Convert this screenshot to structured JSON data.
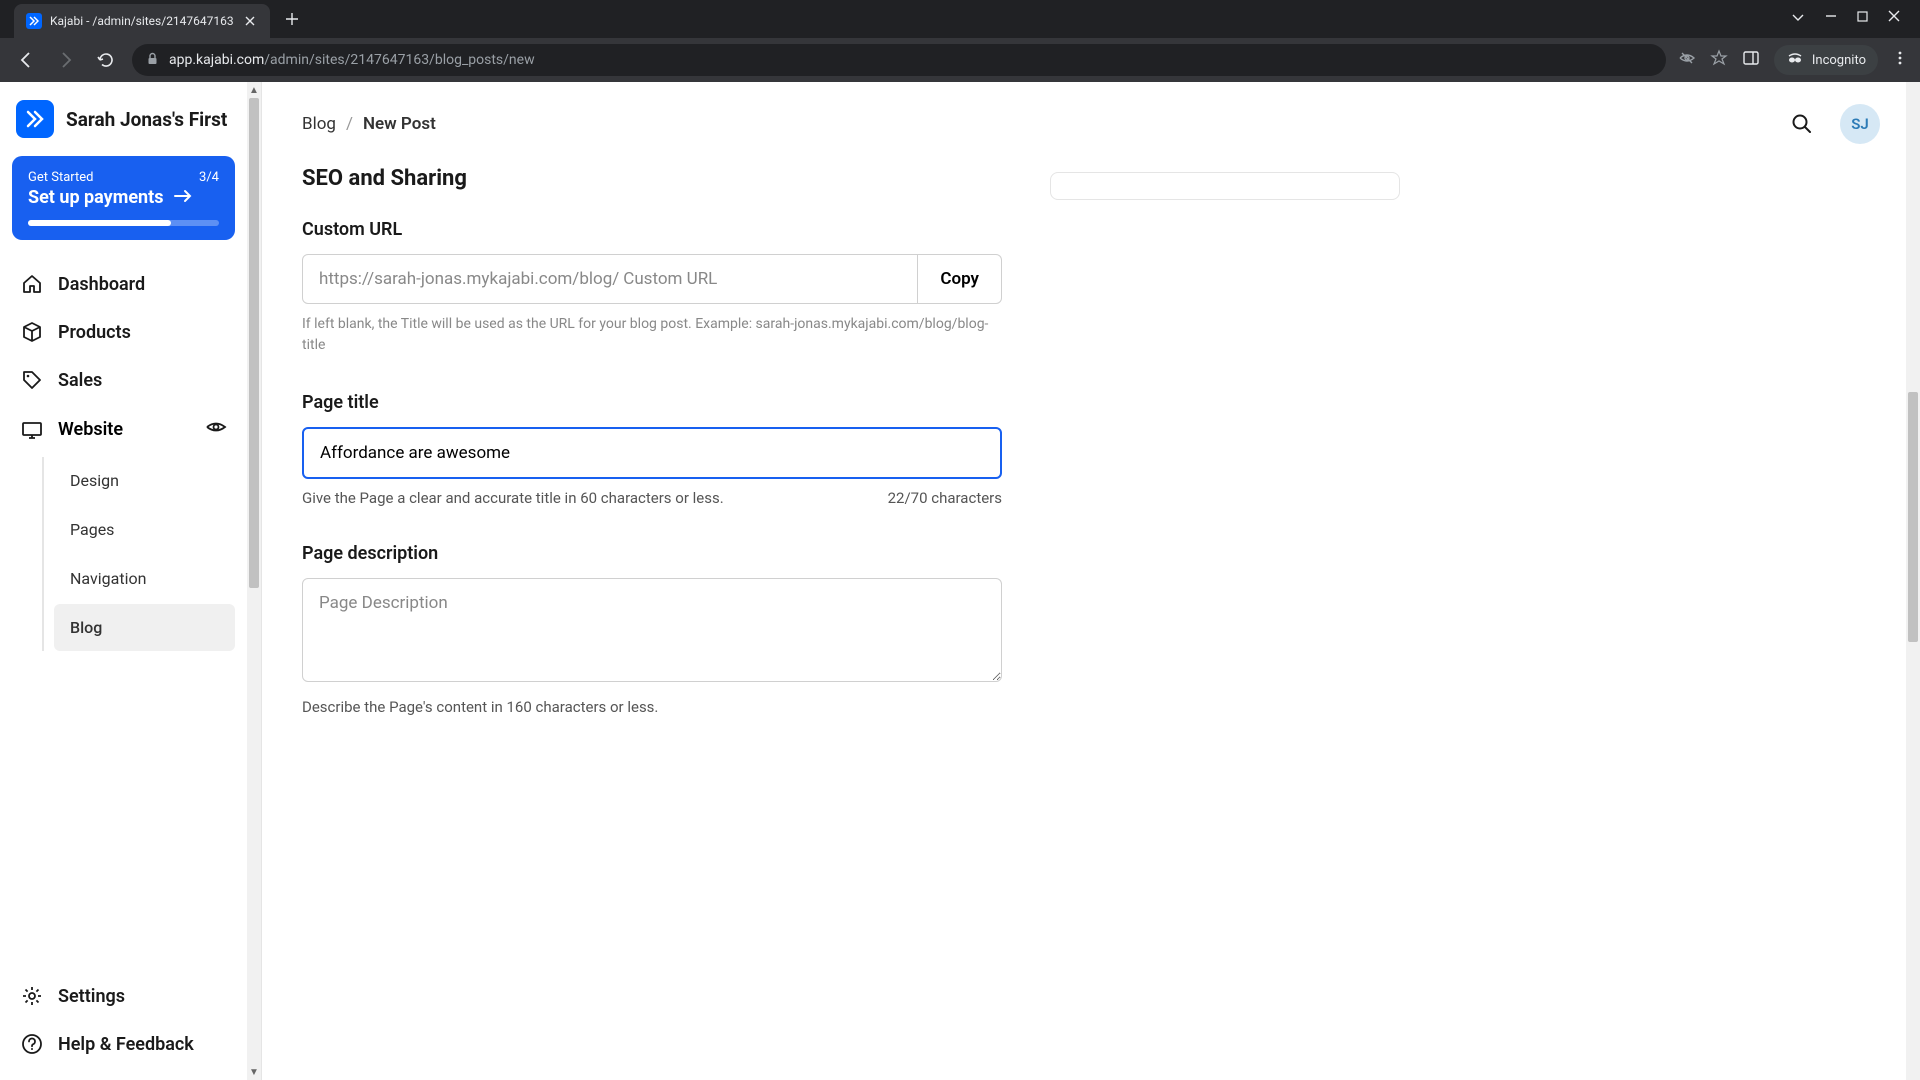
{
  "browser": {
    "tab_title": "Kajabi - /admin/sites/2147647163",
    "url_domain": "app.kajabi.com",
    "url_path": "/admin/sites/2147647163/blog_posts/new",
    "incognito": "Incognito"
  },
  "brand": {
    "name": "Sarah Jonas's First"
  },
  "get_started": {
    "label": "Get Started",
    "count": "3/4",
    "title": "Set up payments"
  },
  "sidebar": {
    "items": [
      {
        "label": "Dashboard"
      },
      {
        "label": "Products"
      },
      {
        "label": "Sales"
      },
      {
        "label": "Website"
      }
    ],
    "website_sub": [
      {
        "label": "Design"
      },
      {
        "label": "Pages"
      },
      {
        "label": "Navigation"
      },
      {
        "label": "Blog"
      }
    ],
    "bottom": [
      {
        "label": "Settings"
      },
      {
        "label": "Help & Feedback"
      }
    ]
  },
  "breadcrumb": {
    "parent": "Blog",
    "current": "New Post"
  },
  "avatar": "SJ",
  "seo": {
    "section_title": "SEO and Sharing",
    "custom_url": {
      "label": "Custom URL",
      "prefix": "https://sarah-jonas.mykajabi.com/blog/",
      "placeholder": "Custom URL",
      "copy": "Copy",
      "help": "If left blank, the Title will be used as the URL for your blog post. Example: sarah-jonas.mykajabi.com/blog/blog-title"
    },
    "page_title": {
      "label": "Page title",
      "value": "Affordance are awesome",
      "help": "Give the Page a clear and accurate title in 60 characters or less.",
      "counter": "22/70 characters"
    },
    "page_description": {
      "label": "Page description",
      "placeholder": "Page Description",
      "help": "Describe the Page's content in 160 characters or less."
    }
  }
}
